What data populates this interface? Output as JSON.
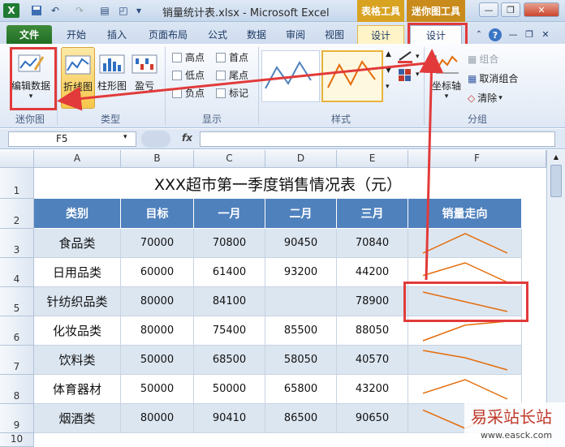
{
  "window": {
    "title": "销量统计表.xlsx - Microsoft Excel",
    "context_tools": [
      "表格工具",
      "迷你图工具"
    ],
    "controls": [
      "minimize",
      "restore",
      "close"
    ]
  },
  "tabs": [
    "文件",
    "开始",
    "插入",
    "页面布局",
    "公式",
    "数据",
    "审阅",
    "视图",
    "设计",
    "设计"
  ],
  "ribbon": {
    "sparkline_group": {
      "button": "编辑数据",
      "label": "迷你图"
    },
    "type_group": {
      "buttons": [
        "折线图",
        "柱形图",
        "盈亏"
      ],
      "label": "类型"
    },
    "show_group": {
      "label": "显示",
      "checks": [
        "高点",
        "首点",
        "低点",
        "尾点",
        "负点",
        "标记"
      ]
    },
    "style_group": {
      "label": "样式"
    },
    "group_group": {
      "label": "分组",
      "buttons": [
        "坐标轴",
        "组合",
        "取消组合",
        "清除"
      ]
    }
  },
  "formula_bar": {
    "name_box": "F5",
    "fx": "fx",
    "value": ""
  },
  "sheet": {
    "columns": [
      "A",
      "B",
      "C",
      "D",
      "E",
      "F"
    ],
    "rows": [
      "1",
      "2",
      "3",
      "4",
      "5",
      "6",
      "7",
      "8",
      "9",
      "10"
    ],
    "title": "XXX超市第一季度销售情况表（元）",
    "headers": [
      "类别",
      "目标",
      "一月",
      "二月",
      "三月",
      "销量走向"
    ],
    "data": [
      [
        "食品类",
        "70000",
        "70800",
        "90450",
        "70840"
      ],
      [
        "日用品类",
        "60000",
        "61400",
        "93200",
        "44200"
      ],
      [
        "针纺织品类",
        "80000",
        "84100",
        "",
        "78900"
      ],
      [
        "化妆品类",
        "80000",
        "75400",
        "85500",
        "88050"
      ],
      [
        "饮料类",
        "50000",
        "68500",
        "58050",
        "40570"
      ],
      [
        "体育器材",
        "50000",
        "50000",
        "65800",
        "43200"
      ],
      [
        "烟酒类",
        "80000",
        "90410",
        "86500",
        "90650"
      ]
    ]
  },
  "colors": {
    "header_fill": "#4F81BD",
    "alt_fill": "#DCE6F1",
    "sparkline": "#E46C0A",
    "annotation": "#E23A3A"
  },
  "watermark": "易采站长站",
  "watermark_url": "www.easck.com"
}
